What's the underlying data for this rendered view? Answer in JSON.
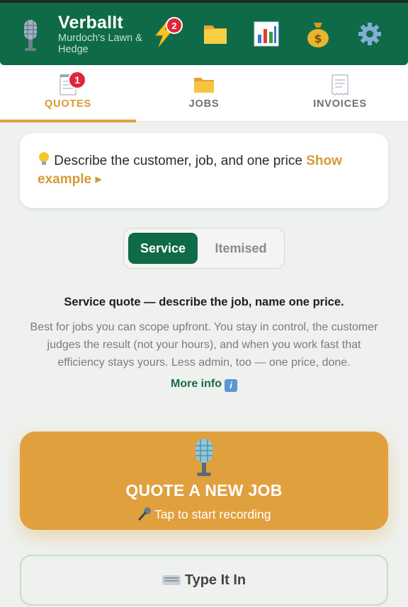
{
  "app": {
    "title": "VerbalIt",
    "subtitle": "Murdoch's Lawn & Hedge"
  },
  "header_icons": [
    {
      "name": "lightning-icon",
      "badge": "2"
    },
    {
      "name": "folder-icon"
    },
    {
      "name": "chart-icon"
    },
    {
      "name": "money-bag-icon"
    },
    {
      "name": "gear-icon"
    }
  ],
  "tabs": [
    {
      "label": "QUOTES",
      "active": true,
      "badge": "1",
      "icon": "notepad-icon"
    },
    {
      "label": "JOBS",
      "active": false,
      "icon": "folder-icon"
    },
    {
      "label": "INVOICES",
      "active": false,
      "icon": "receipt-icon"
    }
  ],
  "hint": {
    "text": "Describe the customer, job, and one price",
    "link": "Show example ▸",
    "icon": "lightbulb-icon"
  },
  "toggle": {
    "selected": "Service",
    "options": [
      "Service",
      "Itemised"
    ]
  },
  "description": {
    "title": "Service quote — describe the job, name one price.",
    "body": "Best for jobs you can scope upfront. You stay in control, the customer judges the result (not your hours), and when you work fast that efficiency stays yours. Less admin, too — one price, done.",
    "more_info": "More info"
  },
  "record_button": {
    "title": "QUOTE A NEW JOB",
    "subtitle": "Tap to start recording"
  },
  "type_button": {
    "label": "Type It In"
  },
  "colors": {
    "brand_green": "#0f6a48",
    "accent_orange": "#e0a03e",
    "badge_red": "#e0263a"
  }
}
